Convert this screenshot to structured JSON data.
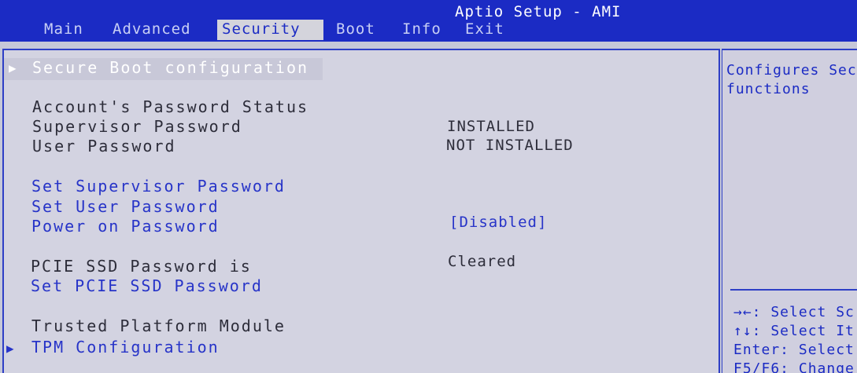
{
  "header": {
    "title": "Aptio Setup - AMI",
    "tabs": [
      {
        "label": "Main"
      },
      {
        "label": "Advanced"
      },
      {
        "label": "Security"
      },
      {
        "label": "Boot"
      },
      {
        "label": "Info"
      },
      {
        "label": "Exit"
      }
    ]
  },
  "menu": {
    "secure_boot": "Secure Boot configuration",
    "account_status_heading": "Account's Password Status",
    "supervisor_password": {
      "label": "Supervisor Password",
      "value": "INSTALLED"
    },
    "user_password": {
      "label": "User Password",
      "value": "NOT INSTALLED"
    },
    "set_supervisor_password": "Set Supervisor Password",
    "set_user_password": "Set User Password",
    "power_on_password": {
      "label": "Power on Password",
      "value": "[Disabled]"
    },
    "pcie_ssd_status": {
      "label": "PCIE SSD Password is",
      "value": "Cleared"
    },
    "set_pcie_ssd_password": "Set PCIE SSD Password",
    "tpm_heading": "Trusted Platform Module",
    "tpm_configuration": "TPM Configuration"
  },
  "help": {
    "line1": "Configures Sec",
    "line2": "functions"
  },
  "keys": {
    "line1": "→←: Select Sc",
    "line2": "↑↓: Select It",
    "line3": "Enter: Select",
    "line4": "F5/F6: Change"
  },
  "colors": {
    "header_bg": "#1b2bc4",
    "panel_bg": "#d3d3e1",
    "link_text": "#2734c8",
    "selected_text": "#ffffff"
  }
}
